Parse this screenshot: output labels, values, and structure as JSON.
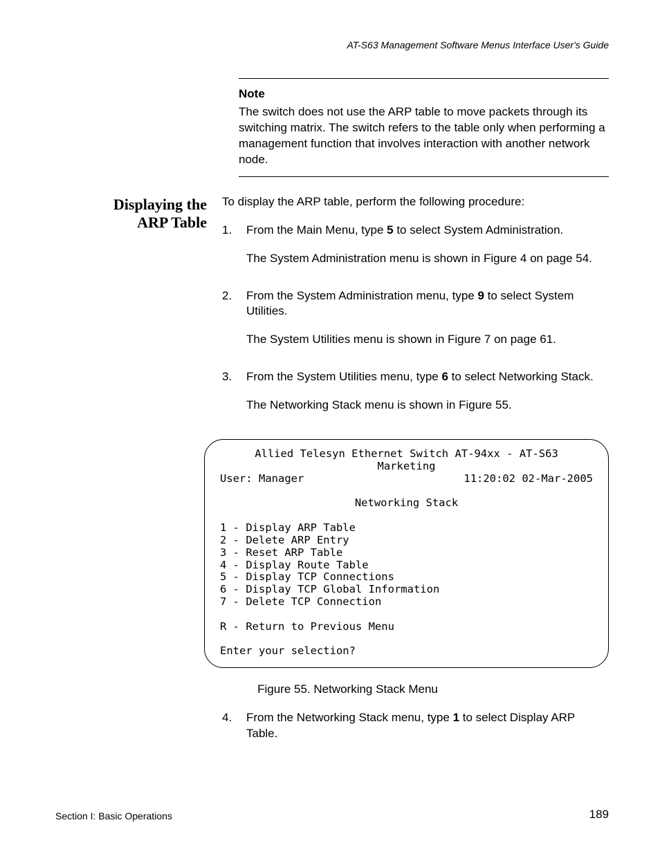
{
  "header": {
    "running": "AT-S63 Management Software Menus Interface User's Guide"
  },
  "note": {
    "label": "Note",
    "text": "The switch does not use the ARP table to move packets through its switching matrix. The switch refers to the table only when performing a management function that involves interaction with another network node."
  },
  "section": {
    "side_heading": "Displaying the ARP Table",
    "intro": "To display the ARP table, perform the following procedure:",
    "steps": [
      {
        "n": "1.",
        "text_pre": "From the Main Menu, type ",
        "key": "5",
        "text_post": " to select System Administration.",
        "follow": "The System Administration menu is shown in Figure 4 on page 54."
      },
      {
        "n": "2.",
        "text_pre": "From the System Administration menu, type ",
        "key": "9",
        "text_post": " to select System Utilities.",
        "follow": "The System Utilities menu is shown in Figure 7 on page 61."
      },
      {
        "n": "3.",
        "text_pre": "From the System Utilities menu, type ",
        "key": "6",
        "text_post": " to select Networking Stack.",
        "follow": "The Networking Stack menu is shown in Figure 55."
      }
    ],
    "step4": {
      "n": "4.",
      "text_pre": "From the Networking Stack menu, type ",
      "key": "1",
      "text_post": " to select Display ARP Table."
    }
  },
  "terminal": {
    "title_line1": "Allied Telesyn Ethernet Switch AT-94xx - AT-S63",
    "title_line2": "Marketing",
    "user_label": "User: Manager",
    "datetime": "11:20:02 02-Mar-2005",
    "menu_title": "Networking Stack",
    "items": [
      "1 - Display ARP Table",
      "2 - Delete ARP Entry",
      "3 - Reset ARP Table",
      "4 - Display Route Table",
      "5 - Display TCP Connections",
      "6 - Display TCP Global Information",
      "7 - Delete TCP Connection"
    ],
    "return": "R - Return to Previous Menu",
    "prompt": "Enter your selection?"
  },
  "caption": "Figure 55. Networking Stack Menu",
  "footer": {
    "left": "Section I: Basic Operations",
    "right": "189"
  }
}
